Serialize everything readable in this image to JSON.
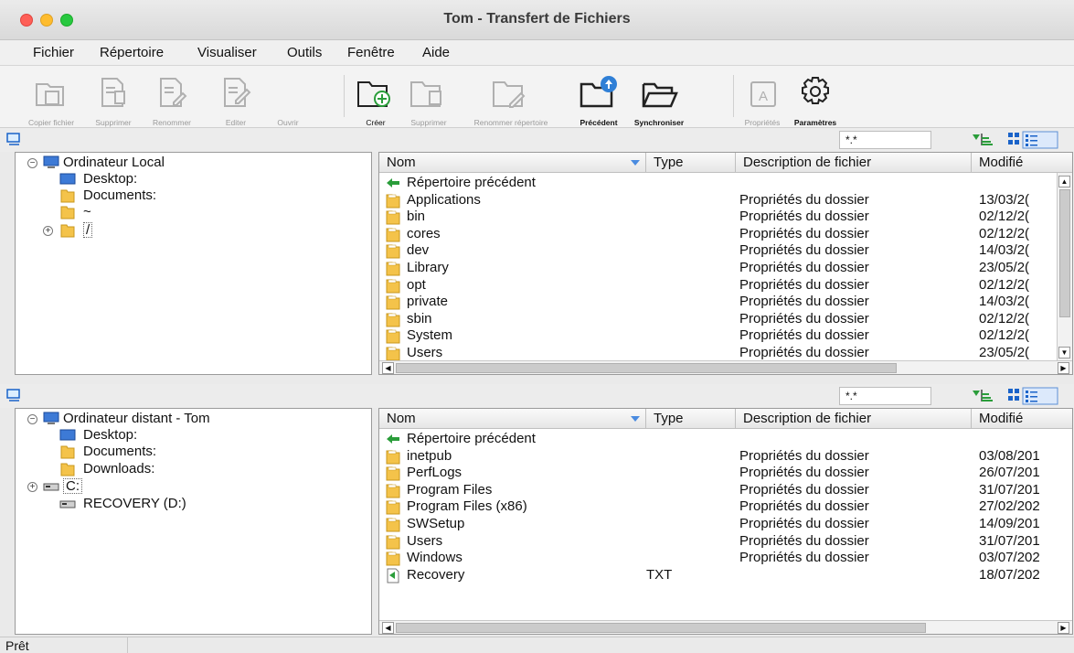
{
  "window": {
    "title": "Tom - Transfert de Fichiers"
  },
  "menu": [
    "Fichier",
    "Répertoire",
    "Visualiser",
    "Outils",
    "Fenêtre",
    "Aide"
  ],
  "toolbar": {
    "copy": "Copier fichier",
    "delete": "Supprimer",
    "rename": "Renommer",
    "edit": "Editer",
    "open": "Ouvrir",
    "create": "Créer",
    "delete_dir": "Supprimer",
    "rename_dir": "Renommer répertoire",
    "previous": "Précédent",
    "sync": "Synchroniser",
    "properties": "Propriétés",
    "settings": "Paramètres"
  },
  "columns": {
    "name": "Nom",
    "type": "Type",
    "desc": "Description de fichier",
    "modified": "Modifié"
  },
  "local": {
    "filter": "*.*",
    "tree": {
      "root": "Ordinateur Local",
      "items": [
        "Desktop:",
        "Documents:",
        "~",
        "/"
      ]
    },
    "files": [
      {
        "name": "Répertoire précédent",
        "type": "",
        "desc": "",
        "date": "",
        "kind": "up"
      },
      {
        "name": "Applications",
        "type": "",
        "desc": "Propriétés du dossier",
        "date": "13/03/2(",
        "kind": "folder"
      },
      {
        "name": "bin",
        "type": "",
        "desc": "Propriétés du dossier",
        "date": "02/12/2(",
        "kind": "folder"
      },
      {
        "name": "cores",
        "type": "",
        "desc": "Propriétés du dossier",
        "date": "02/12/2(",
        "kind": "folder"
      },
      {
        "name": "dev",
        "type": "",
        "desc": "Propriétés du dossier",
        "date": "14/03/2(",
        "kind": "folder"
      },
      {
        "name": "Library",
        "type": "",
        "desc": "Propriétés du dossier",
        "date": "23/05/2(",
        "kind": "folder"
      },
      {
        "name": "opt",
        "type": "",
        "desc": "Propriétés du dossier",
        "date": "02/12/2(",
        "kind": "folder"
      },
      {
        "name": "private",
        "type": "",
        "desc": "Propriétés du dossier",
        "date": "14/03/2(",
        "kind": "folder"
      },
      {
        "name": "sbin",
        "type": "",
        "desc": "Propriétés du dossier",
        "date": "02/12/2(",
        "kind": "folder"
      },
      {
        "name": "System",
        "type": "",
        "desc": "Propriétés du dossier",
        "date": "02/12/2(",
        "kind": "folder"
      },
      {
        "name": "Users",
        "type": "",
        "desc": "Propriétés du dossier",
        "date": "23/05/2(",
        "kind": "folder"
      }
    ]
  },
  "remote": {
    "filter": "*.*",
    "tree": {
      "root": "Ordinateur distant - Tom",
      "items": [
        "Desktop:",
        "Documents:",
        "Downloads:",
        "C:",
        "RECOVERY (D:)"
      ]
    },
    "files": [
      {
        "name": "Répertoire précédent",
        "type": "",
        "desc": "",
        "date": "",
        "kind": "up"
      },
      {
        "name": "inetpub",
        "type": "",
        "desc": "Propriétés du dossier",
        "date": "03/08/201",
        "kind": "folder"
      },
      {
        "name": "PerfLogs",
        "type": "",
        "desc": "Propriétés du dossier",
        "date": "26/07/201",
        "kind": "folder"
      },
      {
        "name": "Program Files",
        "type": "",
        "desc": "Propriétés du dossier",
        "date": "31/07/201",
        "kind": "folder"
      },
      {
        "name": "Program Files (x86)",
        "type": "",
        "desc": "Propriétés du dossier",
        "date": "27/02/202",
        "kind": "folder"
      },
      {
        "name": "SWSetup",
        "type": "",
        "desc": "Propriétés du dossier",
        "date": "14/09/201",
        "kind": "folder"
      },
      {
        "name": "Users",
        "type": "",
        "desc": "Propriétés du dossier",
        "date": "31/07/201",
        "kind": "folder"
      },
      {
        "name": "Windows",
        "type": "",
        "desc": "Propriétés du dossier",
        "date": "03/07/202",
        "kind": "folder"
      },
      {
        "name": "Recovery",
        "type": "TXT",
        "desc": "",
        "date": "18/07/202",
        "kind": "file"
      }
    ]
  },
  "status": "Prêt"
}
